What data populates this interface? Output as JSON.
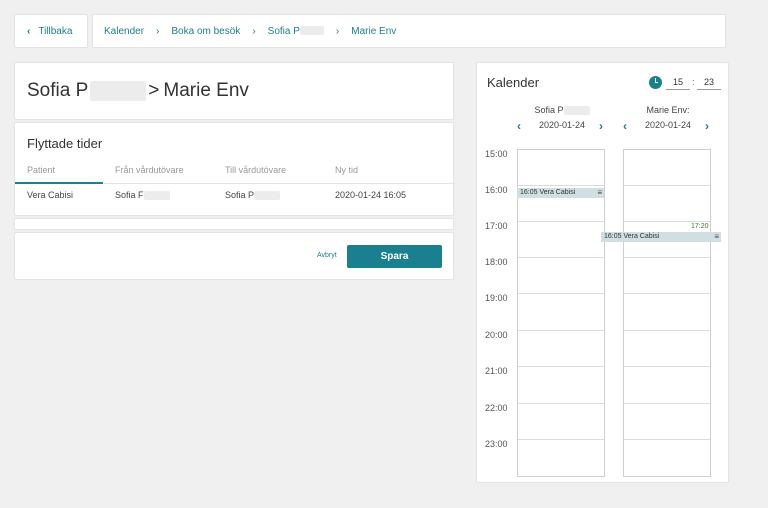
{
  "breadcrumb": {
    "back_label": "Tillbaka",
    "items": [
      "Kalender",
      "Boka om besök",
      "Sofia P",
      "Marie Env"
    ]
  },
  "header": {
    "from_name": "Sofia P",
    "separator": ">",
    "to_name": "Marie Env"
  },
  "moved": {
    "title": "Flyttade tider",
    "columns": [
      "Patient",
      "Från vårdutövare",
      "Till vårdutövare",
      "Ny tid"
    ],
    "rows": [
      {
        "patient": "Vera Cabisi",
        "from": "Sofia F",
        "to": "Sofia P",
        "new_time": "2020-01-24 16:05"
      }
    ]
  },
  "actions": {
    "cancel_label": "Avbryt",
    "save_label": "Spara"
  },
  "calendar": {
    "title": "Kalender",
    "hour_value": "15",
    "minute_value": "23",
    "colon": ":",
    "columns": [
      {
        "name": "Sofia P",
        "date": "2020-01-24"
      },
      {
        "name": "Marie Env:",
        "date": "2020-01-24"
      }
    ],
    "hours": [
      "15:00",
      "16:00",
      "17:00",
      "18:00",
      "19:00",
      "20:00",
      "21:00",
      "22:00",
      "23:00"
    ],
    "events": [
      {
        "label": "16:05 Vera Cabisi"
      },
      {
        "label": "16:05 Vera Cabisi"
      }
    ],
    "marker_time": "17:20"
  },
  "colors": {
    "accent": "#1a7f8e",
    "event_bg": "#cfdfe2",
    "marker": "#4d8a2e"
  },
  "icons": [
    "chevron-left-icon",
    "chevron-right-icon",
    "clock-icon",
    "menu-icon"
  ]
}
